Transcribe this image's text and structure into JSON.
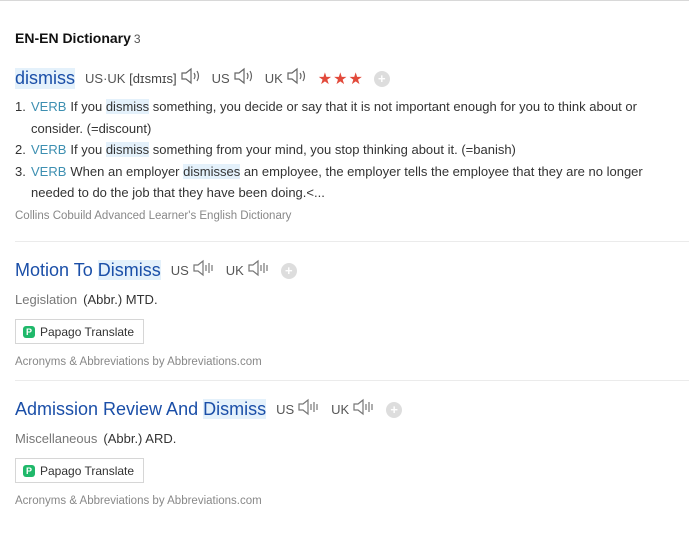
{
  "dictionary": {
    "title": "EN-EN Dictionary",
    "count": "3"
  },
  "entry1": {
    "headword": "dismiss",
    "pron_label": "US·UK",
    "ipa": "[dɪsmɪs]",
    "us_label": "US",
    "uk_label": "UK",
    "stars": "★★★",
    "definitions": [
      {
        "num": "1.",
        "pos": "VERB",
        "pre": "If you ",
        "hl": "dismiss",
        "post": " something, you decide or say that it is not important enough for you to think about or consider. (=discount)"
      },
      {
        "num": "2.",
        "pos": "VERB",
        "pre": "If you ",
        "hl": "dismiss",
        "post": " something from your mind, you stop thinking about it. (=banish)"
      },
      {
        "num": "3.",
        "pos": "VERB",
        "pre": "When an employer ",
        "hl": "dismisses",
        "post": " an employee, the employer tells the employee that they are no longer needed to do the job that they have been doing.<..."
      }
    ],
    "source": "Collins Cobuild Advanced Learner's English Dictionary"
  },
  "entry2": {
    "head_pre": "Motion To ",
    "head_hl": "Dismiss",
    "us_label": "US",
    "uk_label": "UK",
    "category": "Legislation",
    "abbr": "(Abbr.) MTD.",
    "papago": "Papago Translate",
    "source": "Acronyms & Abbreviations by Abbreviations.com"
  },
  "entry3": {
    "head_pre": "Admission Review And ",
    "head_hl": "Dismiss",
    "us_label": "US",
    "uk_label": "UK",
    "category": "Miscellaneous",
    "abbr": "(Abbr.) ARD.",
    "papago": "Papago Translate",
    "source": "Acronyms & Abbreviations by Abbreviations.com"
  },
  "colors": {
    "link": "#1b4fa8",
    "highlight": "#e4f1fb",
    "pos": "#3d8fb1",
    "stars": "#e24a3b",
    "papago": "#1fb86a"
  }
}
